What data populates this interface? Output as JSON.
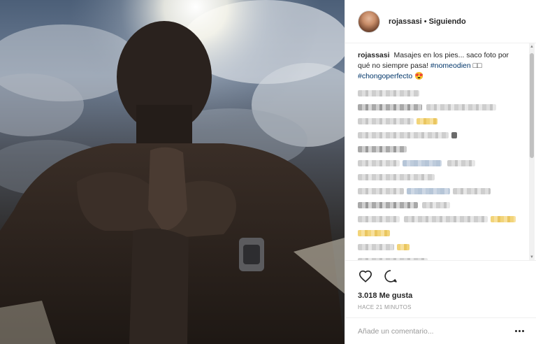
{
  "post": {
    "header": {
      "username": "rojassasi",
      "separator": "•",
      "follow_status": "Siguiendo"
    },
    "caption": {
      "username": "rojassasi",
      "text": "Masajes en los pies... saco foto por qué no siempre pasa!",
      "hashtag_1": "#nomeodien",
      "hashtag_1_suffix": "□□",
      "hashtag_2": "#chongoperfecto",
      "emoji": "😍"
    },
    "actions": {
      "like_icon": "heart-outline-icon",
      "comment_icon": "speech-bubble-icon",
      "likes": "3.018 Me gusta",
      "timestamp": "HACE 21 MINUTOS"
    },
    "comment_box": {
      "placeholder": "Añade un comentario..."
    }
  },
  "colors": {
    "hashtag": "#003569",
    "text": "#262626",
    "muted": "#999999",
    "border": "#efefef"
  }
}
